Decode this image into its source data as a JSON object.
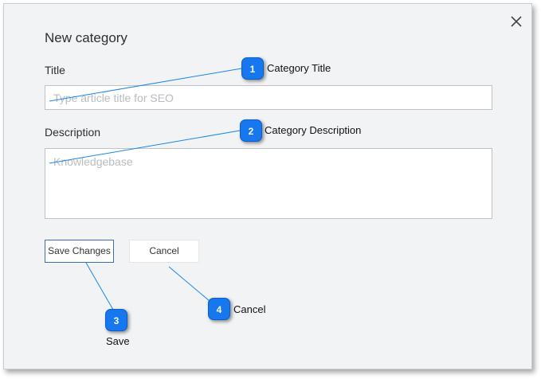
{
  "dialog": {
    "title": "New category",
    "title_field": {
      "label": "Title",
      "placeholder": "Type article title for SEO",
      "value": ""
    },
    "description_field": {
      "label": "Description",
      "placeholder": "Knowledgebase",
      "value": ""
    },
    "save_label": "Save Changes",
    "cancel_label": "Cancel",
    "close_icon": "close-icon"
  },
  "callouts": [
    {
      "number": "1",
      "text": "Category Title"
    },
    {
      "number": "2",
      "text": "Category Description"
    },
    {
      "number": "3",
      "text": "Save"
    },
    {
      "number": "4",
      "text": "Cancel"
    }
  ],
  "colors": {
    "accent": "#1677ee",
    "leader_line": "#1a86e8",
    "dialog_bg": "#f2f3f5"
  }
}
